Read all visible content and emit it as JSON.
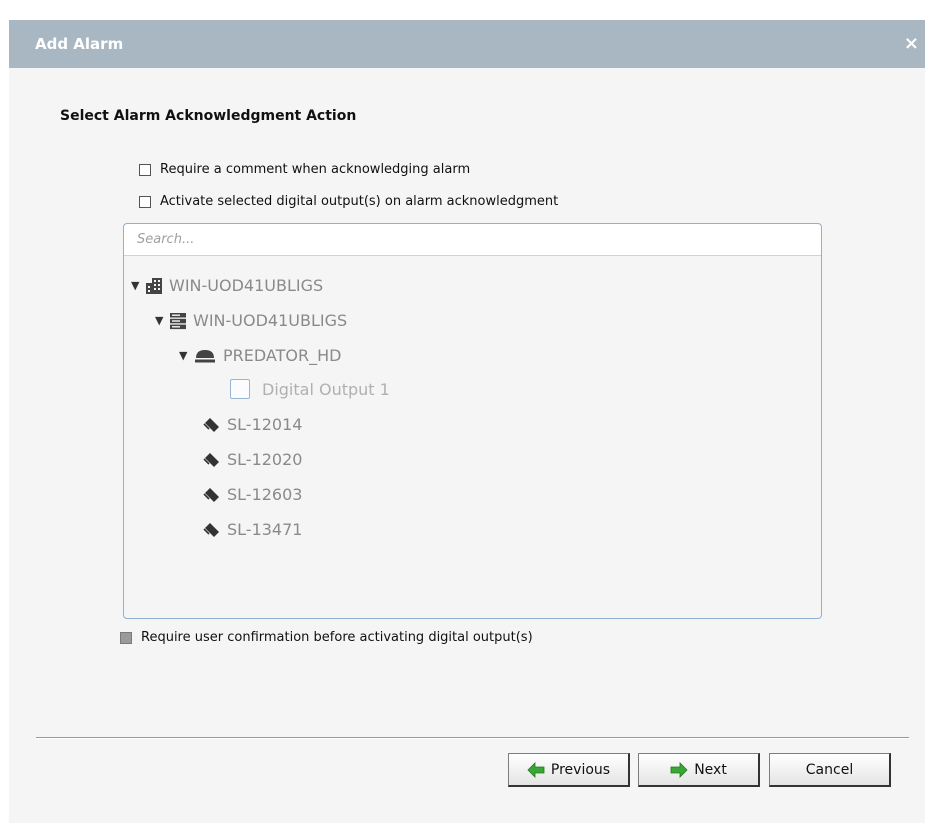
{
  "dialog": {
    "title": "Add Alarm",
    "close_glyph": "×"
  },
  "section_title": "Select Alarm Acknowledgment Action",
  "options": {
    "require_comment": {
      "label": "Require a comment when acknowledging alarm",
      "checked": false
    },
    "activate_outputs": {
      "label": "Activate selected digital output(s) on alarm acknowledgment",
      "checked": false
    },
    "require_confirmation": {
      "label": "Require user confirmation before activating digital output(s)",
      "checked": false,
      "disabled": true
    }
  },
  "search": {
    "placeholder": "Search..."
  },
  "tree": {
    "site": {
      "label": "WIN-UOD41UBLIGS",
      "icon": "building-icon"
    },
    "server": {
      "label": "WIN-UOD41UBLIGS",
      "icon": "server-icon"
    },
    "device": {
      "label": "PREDATOR_HD",
      "icon": "dome-icon"
    },
    "output": {
      "label": "Digital Output 1"
    },
    "locks": [
      {
        "label": "SL-12014",
        "icon": "tag-icon"
      },
      {
        "label": "SL-12020",
        "icon": "tag-icon"
      },
      {
        "label": "SL-12603",
        "icon": "tag-icon"
      },
      {
        "label": "SL-13471",
        "icon": "tag-icon"
      }
    ]
  },
  "buttons": {
    "previous": "Previous",
    "next": "Next",
    "cancel": "Cancel"
  },
  "colors": {
    "titlebar": "#a9b7c2",
    "panel_border": "#8fb1d6",
    "arrow_green": "#3aa635"
  }
}
